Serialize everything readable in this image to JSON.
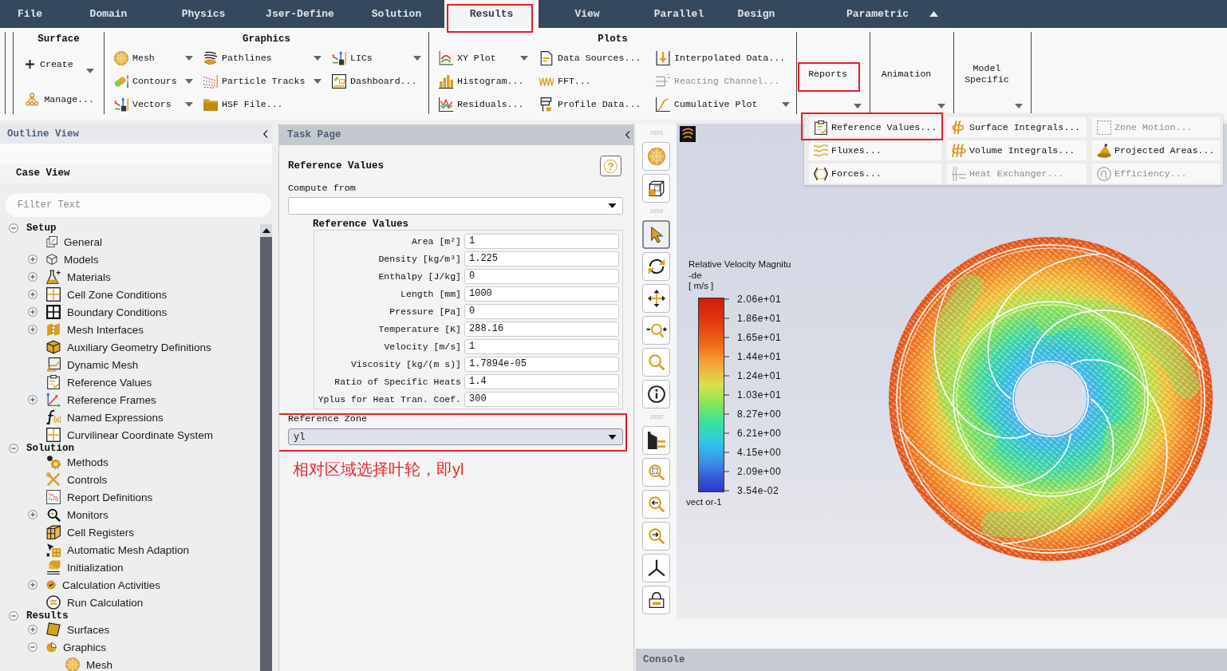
{
  "menu_bar": {
    "tabs": [
      {
        "label": "File",
        "selected": false,
        "highlighted": false
      },
      {
        "label": "Domain",
        "selected": false,
        "highlighted": false
      },
      {
        "label": "Physics",
        "selected": false,
        "highlighted": false
      },
      {
        "label": "Jser-Define",
        "selected": false,
        "highlighted": false
      },
      {
        "label": "Solution",
        "selected": false,
        "highlighted": false
      },
      {
        "label": "Results",
        "selected": true,
        "highlighted": true
      },
      {
        "label": "View",
        "selected": false,
        "highlighted": false
      },
      {
        "label": "Parallel",
        "selected": false,
        "highlighted": false
      },
      {
        "label": "Design",
        "selected": false,
        "highlighted": false
      },
      {
        "label": "Parametric",
        "selected": false,
        "highlighted": false
      }
    ]
  },
  "ribbon": {
    "groups": [
      {
        "title": "Surface",
        "kind": "stack",
        "buttons": [
          {
            "label": "Create",
            "dropdown": true,
            "disabled": false
          },
          {
            "label": "Manage...",
            "dropdown": false,
            "disabled": false
          }
        ]
      },
      {
        "title": "Graphics",
        "kind": "grid",
        "buttons": [
          {
            "label": "Mesh",
            "dropdown": true,
            "disabled": false
          },
          {
            "label": "Contours",
            "dropdown": true,
            "disabled": false
          },
          {
            "label": "Vectors",
            "dropdown": true,
            "disabled": false
          },
          {
            "label": "Pathlines",
            "dropdown": true,
            "disabled": false
          },
          {
            "label": "Particle Tracks",
            "dropdown": true,
            "disabled": false
          },
          {
            "label": "HSF File...",
            "dropdown": false,
            "disabled": false
          },
          {
            "label": "LICs",
            "dropdown": true,
            "disabled": false
          },
          {
            "label": "Dashboard...",
            "dropdown": false,
            "disabled": false
          }
        ]
      },
      {
        "title": "Plots",
        "kind": "grid",
        "buttons": [
          {
            "label": "XY Plot",
            "dropdown": true,
            "disabled": false
          },
          {
            "label": "Histogram...",
            "dropdown": false,
            "disabled": false
          },
          {
            "label": "Residuals...",
            "dropdown": false,
            "disabled": false
          },
          {
            "label": "Data Sources...",
            "dropdown": false,
            "disabled": false
          },
          {
            "label": "FFT...",
            "dropdown": false,
            "disabled": false
          },
          {
            "label": "Profile Data...",
            "dropdown": false,
            "disabled": false
          },
          {
            "label": "Interpolated Data...",
            "dropdown": false,
            "disabled": false
          },
          {
            "label": "Reacting Channel...",
            "dropdown": false,
            "disabled": true
          },
          {
            "label": "Cumulative Plot",
            "dropdown": true,
            "disabled": false
          }
        ]
      }
    ],
    "large_buttons": [
      {
        "label": "Reports",
        "dropdown": true,
        "highlighted": true
      },
      {
        "label": "Animation",
        "dropdown": true,
        "highlighted": false
      },
      {
        "label": "Model Specific",
        "dropdown": true,
        "highlighted": false
      }
    ]
  },
  "reports_menu": {
    "items": [
      {
        "label": "Reference Values...",
        "disabled": false,
        "highlighted": true
      },
      {
        "label": "Surface Integrals...",
        "disabled": false,
        "highlighted": false
      },
      {
        "label": "Zone Motion...",
        "disabled": true,
        "highlighted": false
      },
      {
        "label": "Fluxes...",
        "disabled": false,
        "highlighted": false
      },
      {
        "label": "Volume Integrals...",
        "disabled": false,
        "highlighted": false
      },
      {
        "label": "Projected Areas...",
        "disabled": false,
        "highlighted": false
      },
      {
        "label": "Forces...",
        "disabled": false,
        "highlighted": false
      },
      {
        "label": "Heat Exchanger...",
        "disabled": true,
        "highlighted": false
      },
      {
        "label": "Efficiency...",
        "disabled": true,
        "highlighted": false
      }
    ]
  },
  "outline_view": {
    "title": "Outline View",
    "case_view": "Case View",
    "filter": {
      "placeholder": "Filter Text"
    },
    "tree": [
      {
        "label": "Setup",
        "expanded": true,
        "children": [
          {
            "label": "General"
          },
          {
            "label": "Models",
            "expanded": false
          },
          {
            "label": "Materials",
            "expanded": false
          },
          {
            "label": "Cell Zone Conditions",
            "expanded": false
          },
          {
            "label": "Boundary Conditions",
            "expanded": false
          },
          {
            "label": "Mesh Interfaces",
            "expanded": false
          },
          {
            "label": "Auxiliary Geometry Definitions"
          },
          {
            "label": "Dynamic Mesh"
          },
          {
            "label": "Reference Values"
          },
          {
            "label": "Reference Frames",
            "expanded": false
          },
          {
            "label": "Named Expressions"
          },
          {
            "label": "Curvilinear Coordinate System"
          }
        ]
      },
      {
        "label": "Solution",
        "expanded": true,
        "children": [
          {
            "label": "Methods"
          },
          {
            "label": "Controls"
          },
          {
            "label": "Report Definitions"
          },
          {
            "label": "Monitors",
            "expanded": false
          },
          {
            "label": "Cell Registers"
          },
          {
            "label": "Automatic Mesh Adaption"
          },
          {
            "label": "Initialization"
          },
          {
            "label": "Calculation Activities",
            "expanded": false
          },
          {
            "label": "Run Calculation"
          }
        ]
      },
      {
        "label": "Results",
        "expanded": true,
        "children": [
          {
            "label": "Surfaces",
            "expanded": false
          },
          {
            "label": "Graphics",
            "expanded": true,
            "children": [
              {
                "label": "Mesh"
              }
            ]
          }
        ]
      }
    ]
  },
  "task_page": {
    "title": "Task Page",
    "heading": "Reference Values",
    "help_button": "?",
    "compute_from": {
      "label": "Compute from"
    },
    "reference_values": {
      "title": "Reference Values",
      "fields": [
        {
          "label": "Area [m²]",
          "value": "1"
        },
        {
          "label": "Density [kg/m³]",
          "value": "1.225"
        },
        {
          "label": "Enthalpy [J/kg]",
          "value": "0"
        },
        {
          "label": "Length [mm]",
          "value": "1000"
        },
        {
          "label": "Pressure [Pa]",
          "value": "0"
        },
        {
          "label": "Temperature [K]",
          "value": "288.16"
        },
        {
          "label": "Velocity [m/s]",
          "value": "1"
        },
        {
          "label": "Viscosity [kg/(m s)]",
          "value": "1.7894e-05"
        },
        {
          "label": "Ratio of Specific Heats",
          "value": "1.4"
        },
        {
          "label": "Yplus for Heat Tran. Coef.",
          "value": "300"
        }
      ]
    },
    "reference_zone": {
      "label": "Reference Zone",
      "value": "yl",
      "highlighted": true
    },
    "annotation": "相对区域选择叶轮，即yl"
  },
  "graphics_toolbar": {
    "groups": [
      {
        "buttons": [
          {
            "selected": false
          },
          {
            "selected": false
          }
        ]
      },
      {
        "buttons": [
          {
            "selected": true
          },
          {
            "selected": false
          },
          {
            "selected": false
          },
          {
            "selected": false
          },
          {
            "selected": false
          },
          {
            "selected": false
          }
        ]
      },
      {
        "buttons": [
          {
            "selected": false
          },
          {
            "selected": false
          },
          {
            "selected": false
          },
          {
            "selected": false
          },
          {
            "selected": false
          },
          {
            "selected": false
          }
        ]
      }
    ]
  },
  "graphics_window": {
    "legend": {
      "title": [
        "Relative Velocity Magnitu",
        "-de"
      ],
      "unit": "[ m/s ]",
      "ticks": [
        "2.06e+01",
        "1.86e+01",
        "1.65e+01",
        "1.44e+01",
        "1.24e+01",
        "1.03e+01",
        "8.27e+00",
        "6.21e+00",
        "4.15e+00",
        "2.09e+00",
        "3.54e-02"
      ]
    },
    "plot_name": "vect or-1"
  },
  "console": {
    "title": "Console"
  }
}
